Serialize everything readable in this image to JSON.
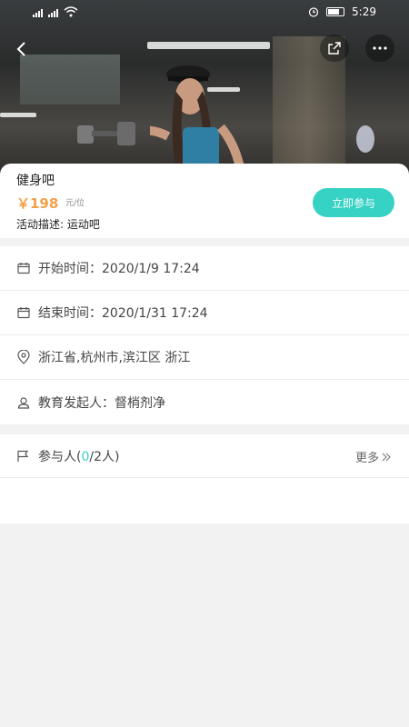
{
  "status_bar": {
    "time": "5:29"
  },
  "activity": {
    "title": "健身吧",
    "price": "￥198",
    "price_unit": "元/位",
    "description": "活动描述: 运动吧",
    "join_label": "立即参与"
  },
  "details": [
    {
      "icon": "calendar-icon",
      "text": "开始时间：2020/1/9 17:24"
    },
    {
      "icon": "calendar-icon",
      "text": "结束时间：2020/1/31 17:24"
    },
    {
      "icon": "location-pin-icon",
      "text": "浙江省,杭州市,滨江区 浙江"
    },
    {
      "icon": "person-icon",
      "text": "教育发起人：督梢剂净"
    }
  ],
  "participants": {
    "label_prefix": "参与人(",
    "current": "0",
    "label_suffix": "/2人)",
    "more_label": "更多"
  },
  "colors": {
    "accent": "#36d2c4",
    "price": "#f0a14a"
  }
}
